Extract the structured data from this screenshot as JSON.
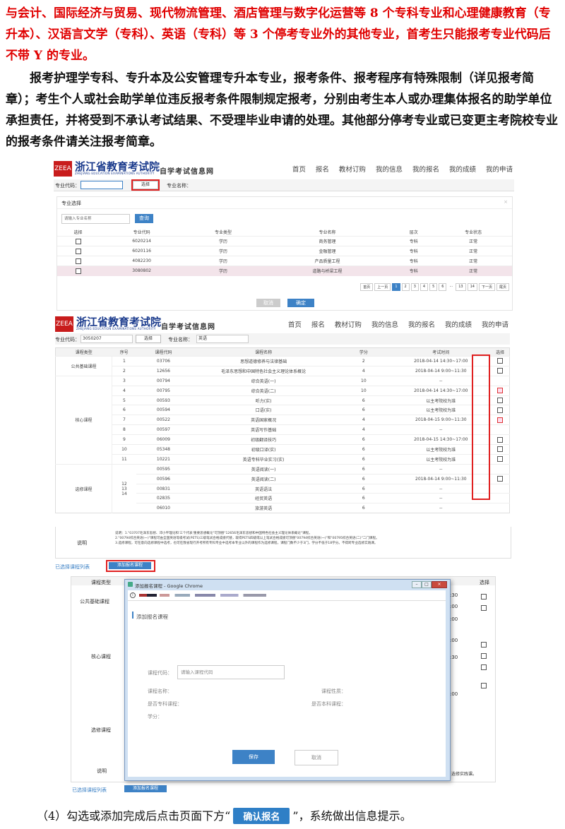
{
  "intro": {
    "para1": "与会计、国际经济与贸易、现代物流管理、酒店管理与数字化运营等 8 个专科专业和心理健康教育（专升本）、汉语言文学（专科）、英语（专科）等 3 个停考专业外的其他专业，首考生只能报考专业代码后不带 Y 的专业。",
    "para2": "报考护理学专科、专升本及公安管理专升本专业，报考条件、报考程序有特殊限制（详见报考简章）；考生个人或社会助学单位违反报考条件限制规定报考，分别由考生本人或办理集体报名的助学单位承担责任，并将受到不承认考试结果、不受理毕业申请的处理。其他部分停考专业或已变更主考院校专业的报考条件请关注报考简章。"
  },
  "site": {
    "logo_cn": "浙江省教育考试院",
    "logo_en": "ZHEJIANG EDUCATION EXAMINATIONS AUTHORITY",
    "logo_sub": "自学考试信息网",
    "nav": [
      "首页",
      "报名",
      "教材订购",
      "我的信息",
      "我的报名",
      "我的成绩",
      "我的申请"
    ]
  },
  "shot1": {
    "code_label": "专业代码：",
    "select_btn": "选择",
    "name_label": "专业名称：",
    "panel_title": "专业选择",
    "search_placeholder": "请输入专业名称",
    "query_btn": "查询",
    "headers": [
      "选择",
      "专业代码",
      "专业类型",
      "专业名称",
      "层次",
      "专业状态"
    ],
    "rows": [
      [
        "6020214",
        "学历",
        "商务管理",
        "专科",
        "正常"
      ],
      [
        "6020116",
        "学历",
        "金融管理",
        "专科",
        "正常"
      ],
      [
        "4082230",
        "学历",
        "产品质量工程",
        "专科",
        "正常"
      ],
      [
        "3080802",
        "学历",
        "道路与桥梁工程",
        "专科",
        "正常"
      ]
    ],
    "pager": [
      "首页",
      "上一页",
      "1",
      "2",
      "3",
      "4",
      "5",
      "6",
      "...",
      "13",
      "14",
      "下一页",
      "尾页"
    ],
    "cancel_btn": "取消",
    "confirm_btn": "确定"
  },
  "shot2": {
    "code_label": "专业代码：",
    "code_value": "3050207",
    "select_btn": "选择",
    "name_label": "专业名称：",
    "name_value": "英语",
    "headers": [
      "课程类型",
      "序号",
      "课程代码",
      "课程名称",
      "学分",
      "考试时间",
      "选择"
    ],
    "groups": [
      {
        "type": "公共基础课程",
        "rows": [
          {
            "no": "1",
            "code": "03706",
            "name": "思想道德修养与法律基础",
            "credit": "2",
            "time": "2018-04-14 14:30~17:00",
            "checked": false
          },
          {
            "no": "2",
            "code": "12656",
            "name": "毛泽东思想和中国特色社会主义理论体系概论",
            "credit": "4",
            "time": "2018-04-14 9:00~11:30",
            "checked": false
          }
        ]
      },
      {
        "type": "核心课程",
        "rows": [
          {
            "no": "3",
            "code": "00794",
            "name": "综合英语(一)",
            "credit": "10",
            "time": "--",
            "checked": null
          },
          {
            "no": "4",
            "code": "00795",
            "name": "综合英语(二)",
            "credit": "10",
            "time": "2018-04-14 14:30~17:00",
            "checked": true
          },
          {
            "no": "5",
            "code": "00593",
            "name": "听力(实)",
            "credit": "6",
            "time": "以主考院校为准",
            "checked": false
          },
          {
            "no": "6",
            "code": "00594",
            "name": "口语(实)",
            "credit": "6",
            "time": "以主考院校为准",
            "checked": false
          },
          {
            "no": "7",
            "code": "00522",
            "name": "英语国家概况",
            "credit": "4",
            "time": "2018-04-15 9:00~11:30",
            "checked": true
          },
          {
            "no": "8",
            "code": "00597",
            "name": "英语写作基础",
            "credit": "4",
            "time": "--",
            "checked": null
          },
          {
            "no": "9",
            "code": "06009",
            "name": "初级翻译技巧",
            "credit": "6",
            "time": "2018-04-15 14:30~17:00",
            "checked": false
          },
          {
            "no": "10",
            "code": "05348",
            "name": "初级口译(实)",
            "credit": "6",
            "time": "以主考院校为准",
            "checked": false
          },
          {
            "no": "11",
            "code": "10221",
            "name": "英语专科毕业实习(实)",
            "credit": "6",
            "time": "以主考院校为准",
            "checked": false
          }
        ]
      },
      {
        "type": "选修课程",
        "nos": "12\n13\n14",
        "rows": [
          {
            "no": "",
            "code": "00595",
            "name": "英语阅读(一)",
            "credit": "6",
            "time": "--",
            "checked": null
          },
          {
            "no": "",
            "code": "00596",
            "name": "英语阅读(二)",
            "credit": "6",
            "time": "2018-04-14 9:00~11:30",
            "checked": false
          },
          {
            "no": "",
            "code": "00831",
            "name": "英语语法",
            "credit": "6",
            "time": "--",
            "checked": null
          },
          {
            "no": "",
            "code": "02835",
            "name": "经贸英语",
            "credit": "6",
            "time": "--",
            "checked": null
          },
          {
            "no": "",
            "code": "06010",
            "name": "旅游英语",
            "credit": "6",
            "time": "--",
            "checked": null
          }
        ]
      }
    ],
    "note_label": "说明",
    "note_lines": [
      "说明：1.\"03707毛泽东思想、邓小平理论和'三个代表'重要思想概论\"可顶替\"12656毛泽东思想和中国特色社会主义理论体系概论\"课程。",
      "2.\"00794综合英语(一)\"课程可由全国英语等级考试(PETS)三级笔试合格成绩代替，取得PETS四级或以上笔试合格成绩可顶替\"00794综合英语(一)\"和\"00795综合英语(二)\"二门课程。",
      "3.选修课程，可在意向选修课程中选考，也可在我省现行开考所有专科专业中选考本专业以外的课程作为选修课程，课程门数不少于3门，学分不低于18学分。不得跨专业选修实践课。"
    ],
    "selected_list": "已选择课程列表",
    "add_btn": "添加报名课程"
  },
  "shot3": {
    "headers": [
      "课程类型",
      "选择"
    ],
    "types": [
      "公共基础课程",
      "核心课程",
      "选修课程",
      "说明"
    ],
    "selected_list": "已选择课程列表",
    "add_btn": "添加报名课程",
    "bg_times": [
      ":30",
      ":00",
      ":00",
      ":00",
      ":30",
      ":00"
    ],
    "bg_hint": "选修实践课。",
    "dialog": {
      "title": "添加报名课程 - Google Chrome",
      "url_icon": "i",
      "heading": "添加报名课程",
      "code_label": "课程代码：",
      "code_placeholder": "请输入课程代码",
      "name_label": "课程名称：",
      "nature_label": "课程性质：",
      "is_specialty": "是否专科课程：",
      "is_bachelor": "是否本科课程：",
      "credit_label": "学分：",
      "save_btn": "保存",
      "cancel_btn": "取消"
    }
  },
  "footer": {
    "prefix": "（4）勾选或添加完成后点击页面下方“",
    "button": "确认报名",
    "suffix": "”，系统做出信息提示。"
  }
}
